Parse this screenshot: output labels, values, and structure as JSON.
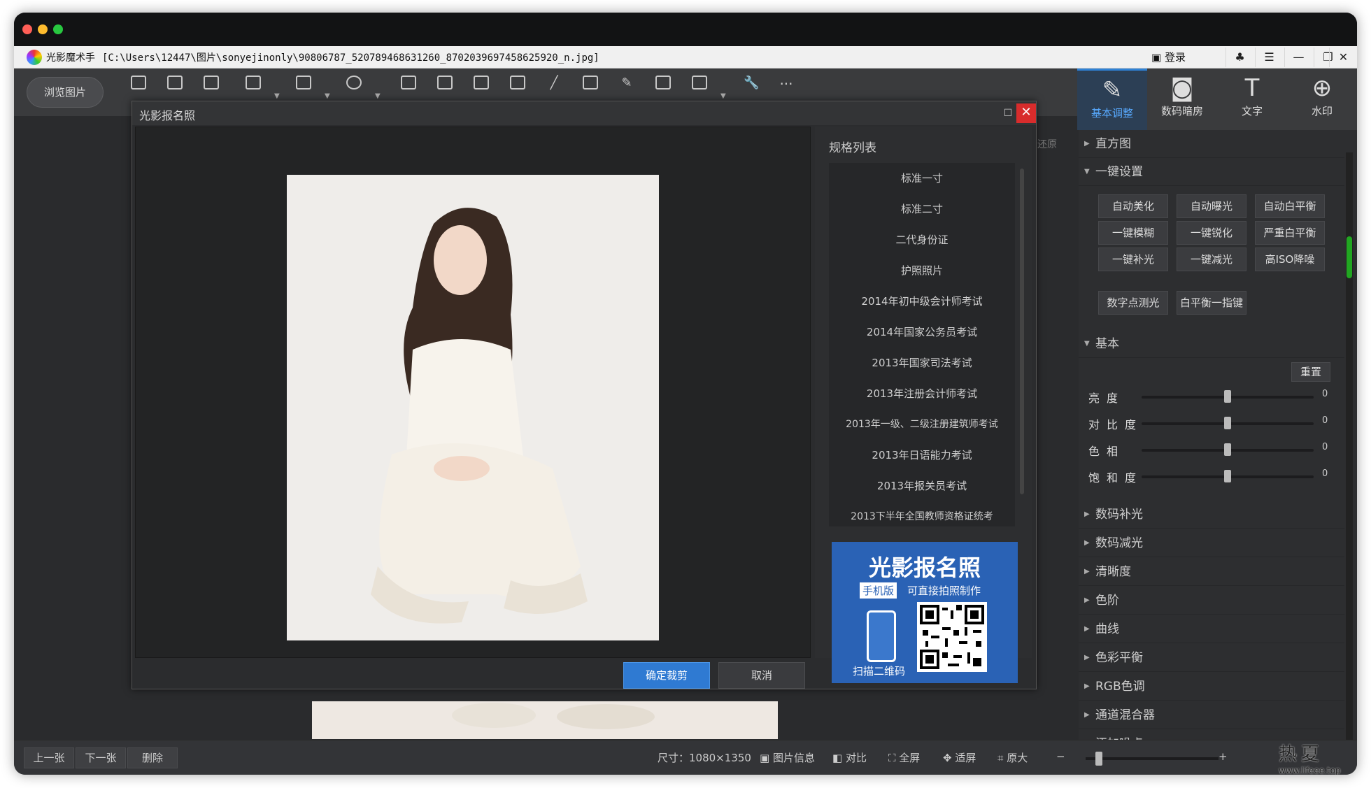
{
  "window": {
    "app_name": "光影魔术手",
    "path": "[C:\\Users\\12447\\图片\\sonyejinonly\\90806787_520789468631260_8702039697458625920_n.jpg]",
    "login_label": "登录"
  },
  "toolbar": {
    "browse_label": "浏览图片",
    "tools": [
      "open",
      "save",
      "save-as",
      "resize",
      "crop",
      "rotate",
      "border",
      "jigsaw",
      "template",
      "print",
      "brush",
      "calendar",
      "pen",
      "batch",
      "layout",
      "tools",
      "more"
    ]
  },
  "right_tabs": [
    {
      "label": "基本调整",
      "icon": "edit-icon"
    },
    {
      "label": "数码暗房",
      "icon": "camera-icon"
    },
    {
      "label": "文字",
      "icon": "text-icon"
    },
    {
      "label": "水印",
      "icon": "watermark-icon"
    }
  ],
  "restore_label": "还原",
  "panel": {
    "histogram": "直方图",
    "one_click": "一键设置",
    "one_click_buttons": [
      "自动美化",
      "自动曝光",
      "自动白平衡",
      "一键模糊",
      "一键锐化",
      "严重白平衡",
      "一键补光",
      "一键减光",
      "高ISO降噪"
    ],
    "extra_buttons": [
      "数字点测光",
      "白平衡一指键"
    ],
    "basic": "基本",
    "reset": "重置",
    "sliders": [
      {
        "name": "亮度",
        "value": "0",
        "level": 0.5
      },
      {
        "name": "对比度",
        "value": "0",
        "level": 0.5
      },
      {
        "name": "色相",
        "value": "0",
        "level": 0.5
      },
      {
        "name": "饱和度",
        "value": "0",
        "level": 0.5
      }
    ],
    "sections": [
      "数码补光",
      "数码减光",
      "清晰度",
      "色阶",
      "曲线",
      "色彩平衡",
      "RGB色调",
      "通道混合器",
      "添加噪点"
    ]
  },
  "dialog": {
    "title": "光影报名照",
    "spec_header": "规格列表",
    "specs": [
      "标准一寸",
      "标准二寸",
      "二代身份证",
      "护照照片",
      "2014年初中级会计师考试",
      "2014年国家公务员考试",
      "2013年国家司法考试",
      "2013年注册会计师考试",
      "2013年一级、二级注册建筑师考试",
      "2013年日语能力考试",
      "2013年报关员考试",
      "2013下半年全国教师资格证统考"
    ],
    "ad_title": "光影报名照",
    "ad_badge": "手机版",
    "ad_sub": "可直接拍照制作",
    "ad_scan": "扫描二维码",
    "confirm": "确定裁剪",
    "cancel": "取消"
  },
  "bottom": {
    "prev": "上一张",
    "next": "下一张",
    "delete": "删除",
    "size": "尺寸：1080×1350",
    "info": "图片信息",
    "compare": "对比",
    "fullscreen": "全屏",
    "fit": "适屏",
    "original": "原大",
    "zoom_level": 0.1
  },
  "watermark": {
    "text": "热夏",
    "url": "www.lifeee.top"
  }
}
